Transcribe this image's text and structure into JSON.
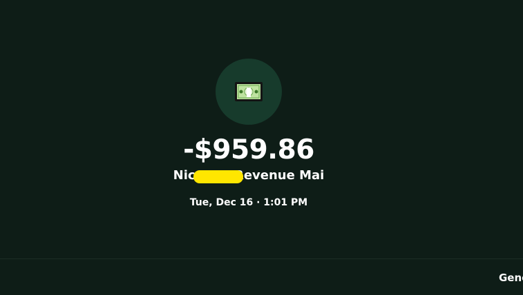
{
  "transaction": {
    "icon": "dollar-bill-icon",
    "amount": "-$959.86",
    "merchant_prefix": "Nic",
    "merchant_suffix": "Revenue Mai",
    "datetime": "Tue, Dec 16 · 1:01 PM"
  },
  "footer": {
    "tab_label": "Gene"
  },
  "colors": {
    "background": "#0e1d17",
    "icon_circle": "#173b2c",
    "redaction": "#ffe600",
    "text": "#ffffff"
  }
}
